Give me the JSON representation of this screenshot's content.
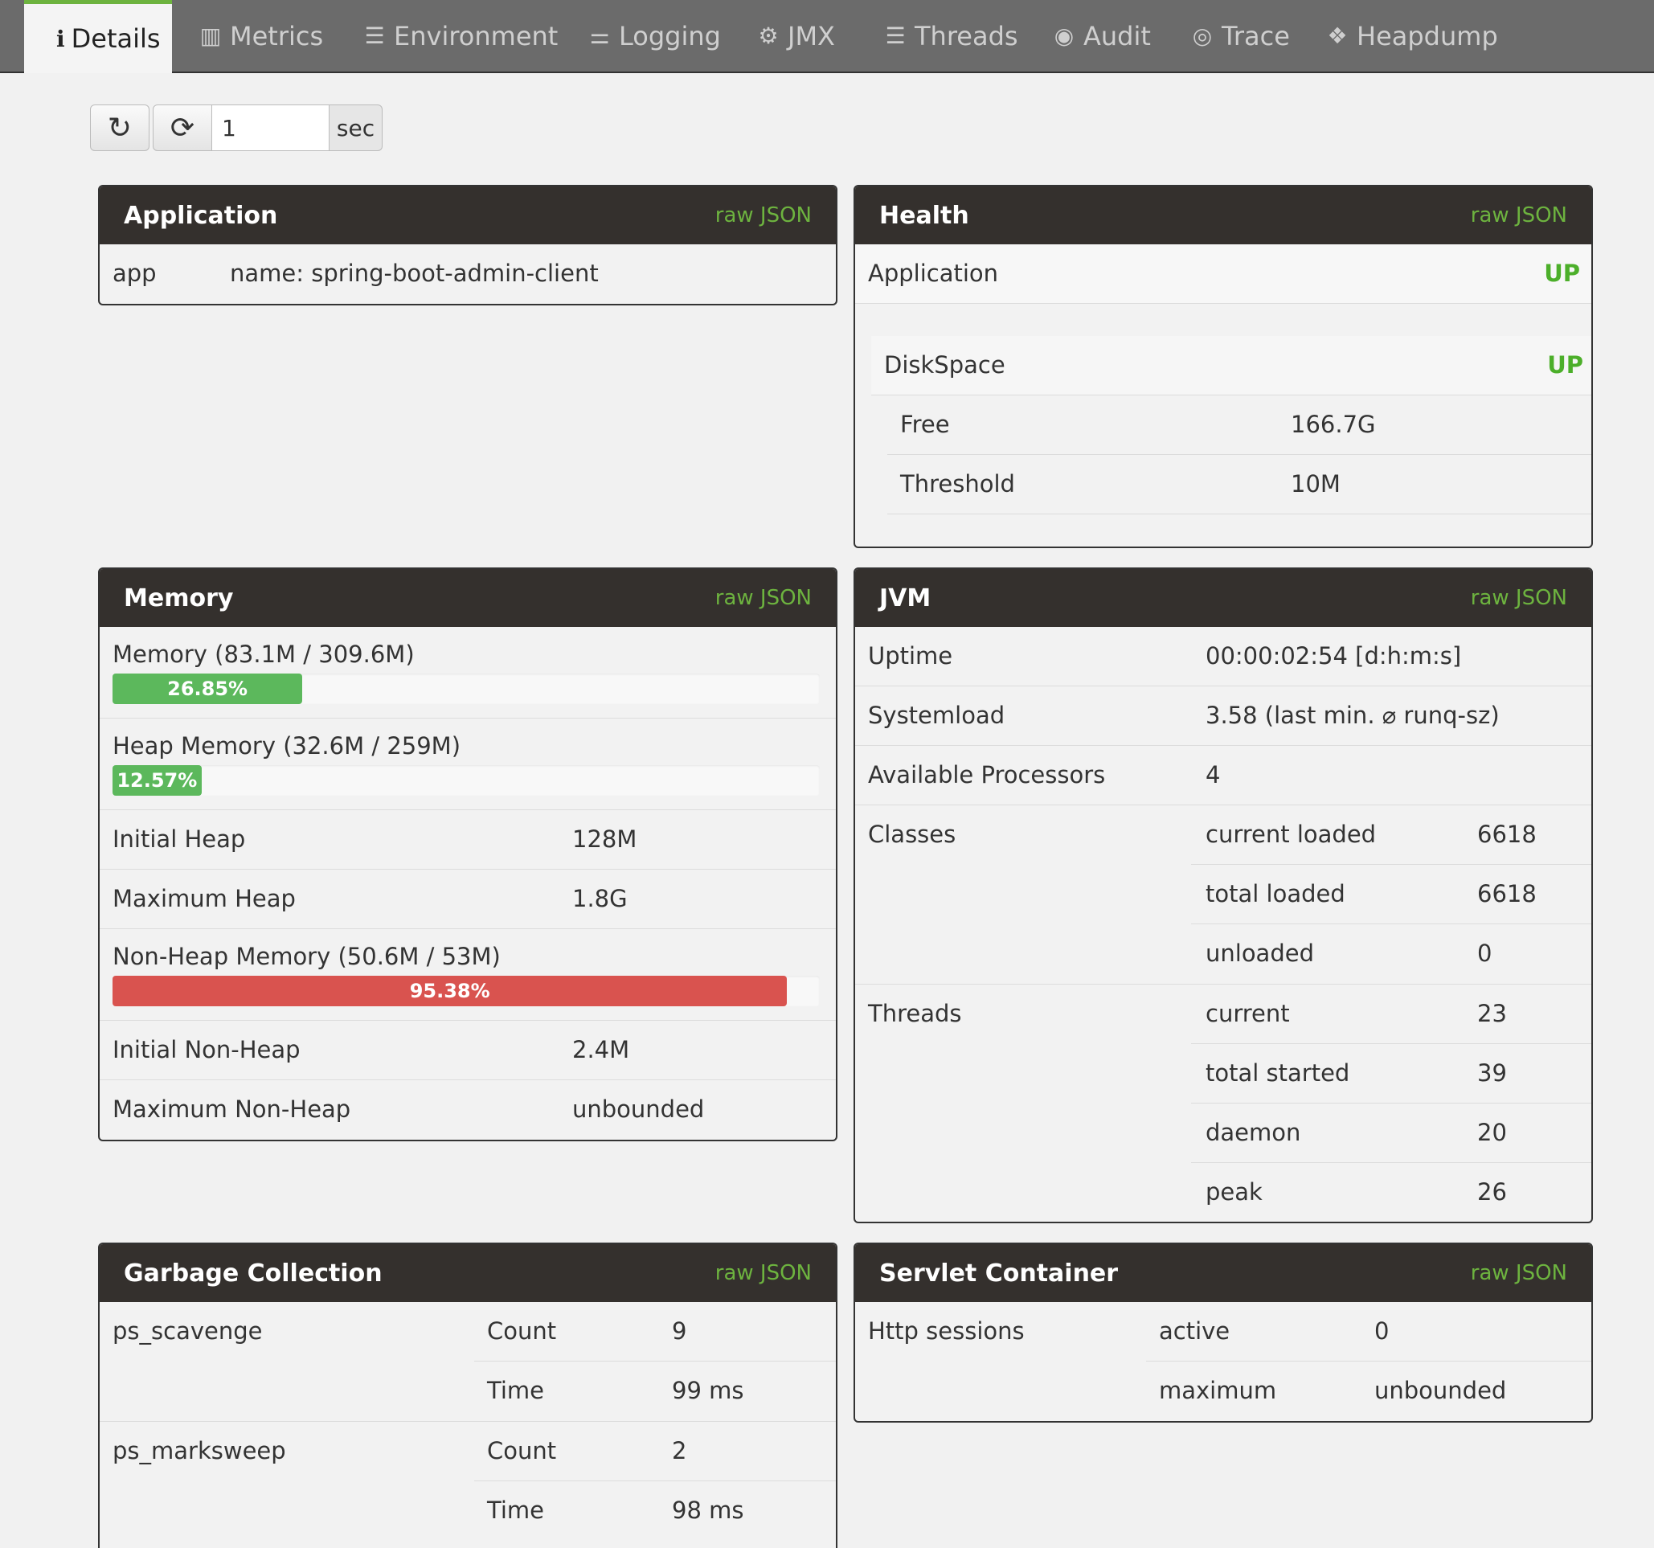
{
  "tabs": [
    {
      "icon": "info-icon",
      "glyph": "ℹ",
      "label": "Details"
    },
    {
      "icon": "bar-chart-icon",
      "glyph": "▥",
      "label": "Metrics"
    },
    {
      "icon": "list-box-icon",
      "glyph": "☰",
      "label": "Environment"
    },
    {
      "icon": "sliders-icon",
      "glyph": "⚌",
      "label": "Logging"
    },
    {
      "icon": "cogs-icon",
      "glyph": "⚙",
      "label": "JMX"
    },
    {
      "icon": "list-icon",
      "glyph": "☰",
      "label": "Threads"
    },
    {
      "icon": "user-circle-icon",
      "glyph": "◉",
      "label": "Audit"
    },
    {
      "icon": "eye-icon",
      "glyph": "◎",
      "label": "Trace"
    },
    {
      "icon": "cubes-icon",
      "glyph": "❖",
      "label": "Heapdump"
    }
  ],
  "controls": {
    "refresh_glyph": "↻",
    "autorefresh_glyph": "⟳",
    "interval": "1",
    "unit": "sec"
  },
  "raw_json": "raw JSON",
  "application": {
    "title": "Application",
    "key": "app",
    "value": "name: spring-boot-admin-client"
  },
  "health": {
    "title": "Health",
    "app_label": "Application",
    "app_status": "UP",
    "disk_label": "DiskSpace",
    "disk_status": "UP",
    "free_label": "Free",
    "free_value": "166.7G",
    "threshold_label": "Threshold",
    "threshold_value": "10M"
  },
  "memory": {
    "title": "Memory",
    "total_label": "Memory (83.1M / 309.6M)",
    "total_pct_text": "26.85%",
    "total_pct": 26.85,
    "heap_label": "Heap Memory (32.6M / 259M)",
    "heap_pct_text": "12.57%",
    "heap_pct": 12.57,
    "initial_heap_label": "Initial Heap",
    "initial_heap": "128M",
    "max_heap_label": "Maximum Heap",
    "max_heap": "1.8G",
    "nonheap_label": "Non-Heap Memory (50.6M / 53M)",
    "nonheap_pct_text": "95.38%",
    "nonheap_pct": 95.38,
    "initial_nonheap_label": "Initial Non-Heap",
    "initial_nonheap": "2.4M",
    "max_nonheap_label": "Maximum Non-Heap",
    "max_nonheap": "unbounded"
  },
  "jvm": {
    "title": "JVM",
    "uptime_label": "Uptime",
    "uptime": "00:00:02:54 [d:h:m:s]",
    "sysload_label": "Systemload",
    "sysload": "3.58 (last min. ⌀ runq-sz)",
    "procs_label": "Available Processors",
    "procs": "4",
    "classes_label": "Classes",
    "classes": [
      {
        "k": "current loaded",
        "v": "6618"
      },
      {
        "k": "total loaded",
        "v": "6618"
      },
      {
        "k": "unloaded",
        "v": "0"
      }
    ],
    "threads_label": "Threads",
    "threads": [
      {
        "k": "current",
        "v": "23"
      },
      {
        "k": "total started",
        "v": "39"
      },
      {
        "k": "daemon",
        "v": "20"
      },
      {
        "k": "peak",
        "v": "26"
      }
    ]
  },
  "gc": {
    "title": "Garbage Collection",
    "collectors": [
      {
        "name": "ps_scavenge",
        "count_label": "Count",
        "count": "9",
        "time_label": "Time",
        "time": "99 ms"
      },
      {
        "name": "ps_marksweep",
        "count_label": "Count",
        "count": "2",
        "time_label": "Time",
        "time": "98 ms"
      }
    ]
  },
  "servlet": {
    "title": "Servlet Container",
    "sessions_label": "Http sessions",
    "active_label": "active",
    "active": "0",
    "max_label": "maximum",
    "max": "unbounded"
  },
  "colors": {
    "accent": "#6db33f",
    "header": "#34302d",
    "danger": "#d9534f",
    "success": "#5cb85c"
  }
}
